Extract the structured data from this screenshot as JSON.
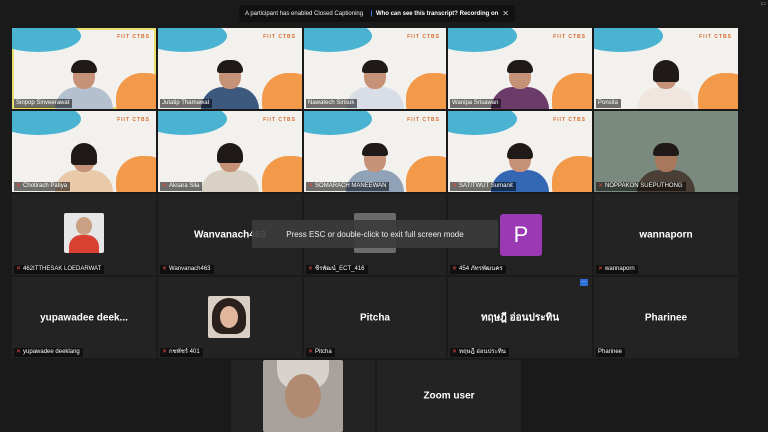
{
  "notification": {
    "message": "A participant has enabled Closed Captioning",
    "link": "Who can see this transcript? Recording on",
    "close": "✕"
  },
  "esc_hint": "Press ESC or double-click to exit full screen mode",
  "corner_label": "▭",
  "tile_logo": "FIIT CTBS",
  "video_tiles": [
    {
      "name": "Siripop Sinveerawat",
      "muted": false
    },
    {
      "name": "Jutatip Thamawat",
      "muted": false
    },
    {
      "name": "Nawatech Sirisuk",
      "muted": false
    },
    {
      "name": "Wanipa Srisawan",
      "muted": false
    },
    {
      "name": "Ponsita",
      "muted": false
    },
    {
      "name": "Chotirach Patiya",
      "muted": true
    },
    {
      "name": "Aksara Sila",
      "muted": true
    },
    {
      "name": "SOMARACH MANEEWAN",
      "muted": true
    },
    {
      "name": "SATITWUT Sumanit",
      "muted": true
    },
    {
      "name": "NOPPAKON SUEPUTHONG",
      "muted": true
    }
  ],
  "other_tiles": [
    {
      "name": "462ITTHESAK LOEDARWAT",
      "big": ""
    },
    {
      "name": "Wanvanach463",
      "big": "Wanvanach463"
    },
    {
      "name": "ชีรพัฒน์_ECT_416",
      "big": ""
    },
    {
      "name": "454 ภัทรพัฒนคร",
      "big": "",
      "avatar": "P"
    },
    {
      "name": "wannaporn",
      "big": "wannaporn"
    },
    {
      "name": "yupawadee deeklang",
      "big": "yupawadee deek..."
    },
    {
      "name": "กชพัชร์ 401",
      "big": ""
    },
    {
      "name": "Pitcha",
      "big": "Pitcha"
    },
    {
      "name": "ทฤษฎี อ่อนประทิน",
      "big": "ทฤษฎี อ่อนประทิน"
    },
    {
      "name": "Pharinee",
      "big": "Pharinee"
    },
    {
      "name": "",
      "big": ""
    },
    {
      "name": "",
      "big": "Zoom user"
    }
  ],
  "colors": {
    "active_border": "#e6e06a",
    "muted_mic": "#e04a3a",
    "avatar_p": "#9b39b5"
  }
}
